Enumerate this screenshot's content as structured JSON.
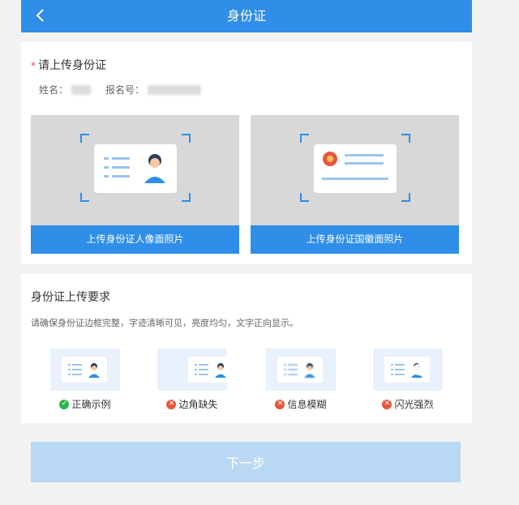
{
  "header": {
    "title": "身份证",
    "back_icon": "chevron-left-icon"
  },
  "upload": {
    "title": "请上传身份证",
    "required_mark": "*",
    "name_label": "姓名：",
    "exam_no_label": "报名号：",
    "front_caption": "上传身份证人像面照片",
    "back_caption": "上传身份证国徽面照片"
  },
  "requirements": {
    "title": "身份证上传要求",
    "description": "请确保身份证边框完整，字迹清晰可见，亮度均匀，文字正向显示。",
    "examples": [
      {
        "label": "正确示例",
        "status": "ok"
      },
      {
        "label": "边角缺失",
        "status": "bad"
      },
      {
        "label": "信息模糊",
        "status": "bad"
      },
      {
        "label": "闪光强烈",
        "status": "bad"
      }
    ]
  },
  "next_button": "下一步",
  "colors": {
    "primary": "#2f8ee8",
    "disabled_button": "#b9d8f4",
    "ok": "#2bb44a",
    "bad": "#e8553f"
  }
}
